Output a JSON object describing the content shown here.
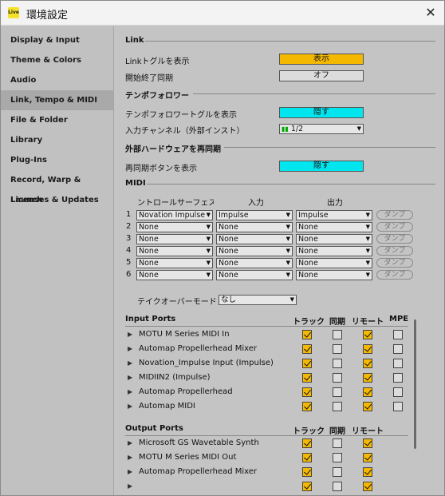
{
  "window": {
    "title": "環境設定",
    "app_icon": "Live"
  },
  "colors": {
    "orange": "#f5b800",
    "cyan": "#00e5ee",
    "toggle_off": "#dcdcdc"
  },
  "sidebar": {
    "items": [
      "Display & Input",
      "Theme & Colors",
      "Audio",
      "Link, Tempo & MIDI",
      "File & Folder",
      "Library",
      "Plug-Ins",
      "Record, Warp & Launch",
      "Licenses & Updates"
    ],
    "active": "Link, Tempo & MIDI"
  },
  "link": {
    "title": "Link",
    "show_toggle_label": "Linkトグルを表示",
    "show_toggle_value": "表示",
    "start_stop_label": "開始終了同期",
    "start_stop_value": "オフ"
  },
  "tempo_follower": {
    "title": "テンポフォロワー",
    "show_toggle_label": "テンポフォロワートグルを表示",
    "show_toggle_value": "隠す",
    "input_channel_label": "入力チャンネル（外部インスト）",
    "input_channel_value": "1/2"
  },
  "resync": {
    "title": "外部ハードウェアを再同期",
    "show_button_label": "再同期ボタンを表示",
    "show_button_value": "隠す"
  },
  "midi": {
    "title": "MIDI",
    "col_control_surface": "ントロールサーフェス",
    "col_input": "入力",
    "col_output": "出力",
    "dump_label": "ダンプ",
    "rows": [
      {
        "num": "1",
        "surface": "Novation Impulse",
        "input": "Impulse",
        "output": "Impulse"
      },
      {
        "num": "2",
        "surface": "None",
        "input": "None",
        "output": "None"
      },
      {
        "num": "3",
        "surface": "None",
        "input": "None",
        "output": "None"
      },
      {
        "num": "4",
        "surface": "None",
        "input": "None",
        "output": "None"
      },
      {
        "num": "5",
        "surface": "None",
        "input": "None",
        "output": "None"
      },
      {
        "num": "6",
        "surface": "None",
        "input": "None",
        "output": "None"
      }
    ],
    "takeover_label": "テイクオーバーモード",
    "takeover_value": "なし"
  },
  "input_ports": {
    "title": "Input Ports",
    "col_track": "トラック",
    "col_sync": "同期",
    "col_remote": "リモート",
    "col_mpe": "MPE",
    "rows": [
      {
        "name": "MOTU M Series MIDI In",
        "track": true,
        "sync": false,
        "remote": true,
        "mpe": false
      },
      {
        "name": "Automap Propellerhead Mixer",
        "track": true,
        "sync": false,
        "remote": true,
        "mpe": false
      },
      {
        "name": "Novation_Impulse Input (Impulse)",
        "track": true,
        "sync": false,
        "remote": true,
        "mpe": false
      },
      {
        "name": "MIDIIN2 (Impulse)",
        "track": true,
        "sync": false,
        "remote": true,
        "mpe": false
      },
      {
        "name": "Automap Propellerhead",
        "track": true,
        "sync": false,
        "remote": true,
        "mpe": false
      },
      {
        "name": "Automap MIDI",
        "track": true,
        "sync": false,
        "remote": true,
        "mpe": false
      }
    ]
  },
  "output_ports": {
    "title": "Output Ports",
    "col_track": "トラック",
    "col_sync": "同期",
    "col_remote": "リモート",
    "rows": [
      {
        "name": "Microsoft GS Wavetable Synth",
        "track": true,
        "sync": false,
        "remote": true
      },
      {
        "name": "MOTU M Series MIDI Out",
        "track": true,
        "sync": false,
        "remote": true
      },
      {
        "name": "Automap Propellerhead Mixer",
        "track": true,
        "sync": false,
        "remote": true
      },
      {
        "name": "",
        "track": true,
        "sync": false,
        "remote": true
      }
    ]
  }
}
